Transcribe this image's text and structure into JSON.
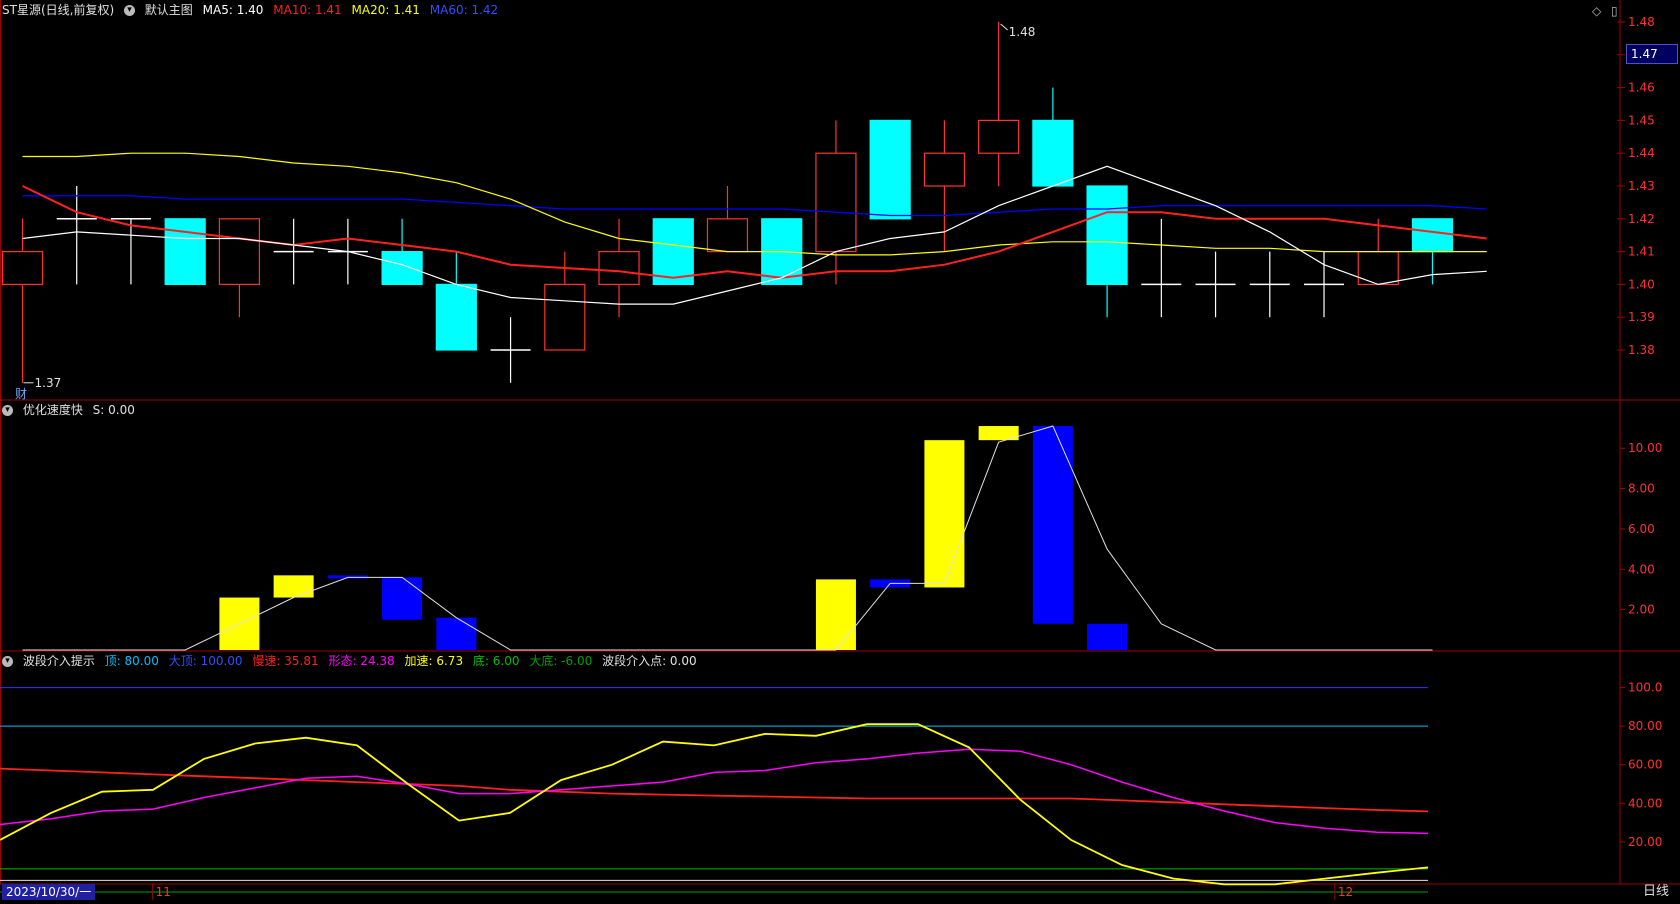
{
  "main_header": {
    "stock": "ST星源(日线,前复权)",
    "template": "默认主图",
    "ma5": "MA5: 1.40",
    "ma10": "MA10: 1.41",
    "ma20": "MA20: 1.41",
    "ma60": "MA60: 1.42"
  },
  "sub1_header": {
    "name": "优化速度快",
    "value": "S: 0.00"
  },
  "sub2_header": {
    "name": "波段介入提示",
    "top": "顶: 80.00",
    "big_top": "大顶: 100.00",
    "slow": "慢速: 35.81",
    "shape": "形态: 24.38",
    "accel": "加速: 6.73",
    "bottom": "底: 6.00",
    "big_bottom": "大底: -6.00",
    "entry": "波段介入点: 0.00"
  },
  "current_price": "1.47",
  "date_label": "2023/10/30/一",
  "period_label": "日线",
  "finance_marker": "财",
  "colors": {
    "up": "#ff3232",
    "down": "#00ffff",
    "ma5": "#ffffff",
    "ma10": "#ff2020",
    "ma20": "#ffff00",
    "ma60": "#0000ff",
    "slow": "#ff2020",
    "shape": "#ff00ff",
    "accel": "#ffff00",
    "top": "#00bfff",
    "big_top": "#3030ff",
    "bottom": "#00c000",
    "big_bottom": "#00a000"
  },
  "chart_data": [
    {
      "type": "candlestick",
      "name": "ST星源",
      "ylim": [
        1.365,
        1.49
      ],
      "yticks": [
        "1.48",
        "1.47",
        "1.46",
        "1.45",
        "1.44",
        "1.43",
        "1.42",
        "1.41",
        "1.40",
        "1.39",
        "1.38"
      ],
      "high_mark": "1.48",
      "low_mark": "1.37",
      "candles": [
        {
          "o": 1.4,
          "c": 1.41,
          "h": 1.42,
          "l": 1.37
        },
        {
          "o": 1.42,
          "c": 1.42,
          "h": 1.43,
          "l": 1.4
        },
        {
          "o": 1.42,
          "c": 1.42,
          "h": 1.42,
          "l": 1.4
        },
        {
          "o": 1.42,
          "c": 1.4,
          "h": 1.42,
          "l": 1.4
        },
        {
          "o": 1.4,
          "c": 1.42,
          "h": 1.42,
          "l": 1.39
        },
        {
          "o": 1.41,
          "c": 1.41,
          "h": 1.42,
          "l": 1.4
        },
        {
          "o": 1.41,
          "c": 1.41,
          "h": 1.42,
          "l": 1.4
        },
        {
          "o": 1.41,
          "c": 1.4,
          "h": 1.42,
          "l": 1.4
        },
        {
          "o": 1.4,
          "c": 1.38,
          "h": 1.41,
          "l": 1.38
        },
        {
          "o": 1.38,
          "c": 1.38,
          "h": 1.39,
          "l": 1.37
        },
        {
          "o": 1.38,
          "c": 1.4,
          "h": 1.41,
          "l": 1.38
        },
        {
          "o": 1.4,
          "c": 1.41,
          "h": 1.42,
          "l": 1.39
        },
        {
          "o": 1.42,
          "c": 1.4,
          "h": 1.42,
          "l": 1.4
        },
        {
          "o": 1.41,
          "c": 1.42,
          "h": 1.43,
          "l": 1.41
        },
        {
          "o": 1.42,
          "c": 1.4,
          "h": 1.42,
          "l": 1.4
        },
        {
          "o": 1.41,
          "c": 1.44,
          "h": 1.45,
          "l": 1.4
        },
        {
          "o": 1.45,
          "c": 1.42,
          "h": 1.45,
          "l": 1.42
        },
        {
          "o": 1.43,
          "c": 1.44,
          "h": 1.45,
          "l": 1.41
        },
        {
          "o": 1.44,
          "c": 1.45,
          "h": 1.48,
          "l": 1.43
        },
        {
          "o": 1.45,
          "c": 1.43,
          "h": 1.46,
          "l": 1.43
        },
        {
          "o": 1.43,
          "c": 1.4,
          "h": 1.43,
          "l": 1.39
        },
        {
          "o": 1.4,
          "c": 1.4,
          "h": 1.42,
          "l": 1.39
        },
        {
          "o": 1.4,
          "c": 1.4,
          "h": 1.41,
          "l": 1.39
        },
        {
          "o": 1.4,
          "c": 1.4,
          "h": 1.41,
          "l": 1.39
        },
        {
          "o": 1.4,
          "c": 1.4,
          "h": 1.41,
          "l": 1.39
        },
        {
          "o": 1.4,
          "c": 1.41,
          "h": 1.42,
          "l": 1.4
        },
        {
          "o": 1.42,
          "c": 1.41,
          "h": 1.42,
          "l": 1.4
        }
      ],
      "ma5": [
        1.414,
        1.416,
        1.415,
        1.414,
        1.414,
        1.412,
        1.41,
        1.406,
        1.4,
        1.396,
        1.395,
        1.394,
        1.394,
        1.398,
        1.402,
        1.41,
        1.414,
        1.416,
        1.424,
        1.43,
        1.436,
        1.43,
        1.424,
        1.416,
        1.406,
        1.4,
        1.403,
        1.404
      ],
      "ma10": [
        1.43,
        1.422,
        1.418,
        1.416,
        1.414,
        1.412,
        1.414,
        1.412,
        1.41,
        1.406,
        1.405,
        1.404,
        1.402,
        1.404,
        1.402,
        1.404,
        1.404,
        1.406,
        1.41,
        1.416,
        1.422,
        1.422,
        1.42,
        1.42,
        1.42,
        1.418,
        1.416,
        1.414
      ],
      "ma20": [
        1.439,
        1.439,
        1.44,
        1.44,
        1.439,
        1.437,
        1.436,
        1.434,
        1.431,
        1.426,
        1.419,
        1.414,
        1.412,
        1.41,
        1.41,
        1.409,
        1.409,
        1.41,
        1.412,
        1.413,
        1.413,
        1.412,
        1.411,
        1.411,
        1.41,
        1.41,
        1.41,
        1.41
      ],
      "ma60": [
        1.427,
        1.427,
        1.427,
        1.426,
        1.426,
        1.426,
        1.426,
        1.426,
        1.425,
        1.424,
        1.423,
        1.423,
        1.423,
        1.423,
        1.423,
        1.422,
        1.421,
        1.421,
        1.422,
        1.423,
        1.423,
        1.424,
        1.424,
        1.424,
        1.424,
        1.424,
        1.424,
        1.423
      ]
    },
    {
      "type": "bar",
      "name": "优化速度快",
      "ylim": [
        0,
        11.3
      ],
      "yticks": [
        "10.00",
        "8.00",
        "6.00",
        "4.00",
        "2.00"
      ],
      "bars": [
        {
          "i": 4,
          "lo": 0,
          "hi": 2.6,
          "color": "yellow"
        },
        {
          "i": 5,
          "lo": 2.6,
          "hi": 3.7,
          "color": "yellow"
        },
        {
          "i": 6,
          "lo": 3.55,
          "hi": 3.7,
          "color": "blue"
        },
        {
          "i": 7,
          "lo": 1.5,
          "hi": 3.6,
          "color": "blue"
        },
        {
          "i": 8,
          "lo": 0,
          "hi": 1.6,
          "color": "blue"
        },
        {
          "i": 15,
          "lo": 0,
          "hi": 3.5,
          "color": "yellow"
        },
        {
          "i": 16,
          "lo": 3.1,
          "hi": 3.5,
          "color": "blue"
        },
        {
          "i": 17,
          "lo": 3.1,
          "hi": 10.4,
          "color": "yellow"
        },
        {
          "i": 18,
          "lo": 10.4,
          "hi": 11.1,
          "color": "yellow"
        },
        {
          "i": 19,
          "lo": 1.3,
          "hi": 11.1,
          "color": "blue"
        },
        {
          "i": 20,
          "lo": 0,
          "hi": 1.3,
          "color": "blue"
        }
      ],
      "line": [
        0,
        0,
        0,
        0,
        1.3,
        2.6,
        3.6,
        3.6,
        1.6,
        0,
        0,
        0,
        0,
        0,
        0,
        0,
        3.3,
        3.3,
        10.3,
        11.1,
        5.0,
        1.3,
        0,
        0,
        0,
        0,
        0
      ]
    },
    {
      "type": "line",
      "name": "波段介入提示",
      "ylim": [
        -6,
        106
      ],
      "yticks": [
        "100.0",
        "80.00",
        "60.00",
        "40.00",
        "20.00"
      ],
      "hlines": {
        "top": 80,
        "big_top": 100,
        "bottom": 6,
        "big_bottom": -6,
        "entry": 0
      },
      "slow": [
        58,
        57,
        56,
        55,
        54,
        53,
        52,
        51,
        50,
        49,
        47,
        46,
        45,
        44.5,
        44,
        43.5,
        43,
        42.5,
        42.5,
        42.5,
        42.5,
        42.5,
        41.5,
        40.5,
        39.5,
        38.5,
        37.5,
        36.5,
        35.81
      ],
      "shape": [
        29,
        32,
        36,
        37,
        43,
        48,
        53,
        54,
        50,
        45,
        45,
        47,
        49,
        51,
        56,
        57,
        61,
        63,
        66,
        68,
        67,
        60,
        51,
        43,
        36,
        30,
        27,
        25,
        24.38
      ],
      "accel": [
        21,
        35,
        46,
        47,
        63,
        71,
        74,
        70,
        50,
        31,
        35,
        52,
        60,
        72,
        70,
        76,
        75,
        81,
        81,
        69,
        42,
        21,
        8,
        1,
        -2,
        -2,
        1,
        4,
        6.73
      ]
    }
  ],
  "x_axis": {
    "month_labels": [
      "11",
      "12"
    ],
    "month_positions": [
      2.4,
      24.2
    ]
  }
}
